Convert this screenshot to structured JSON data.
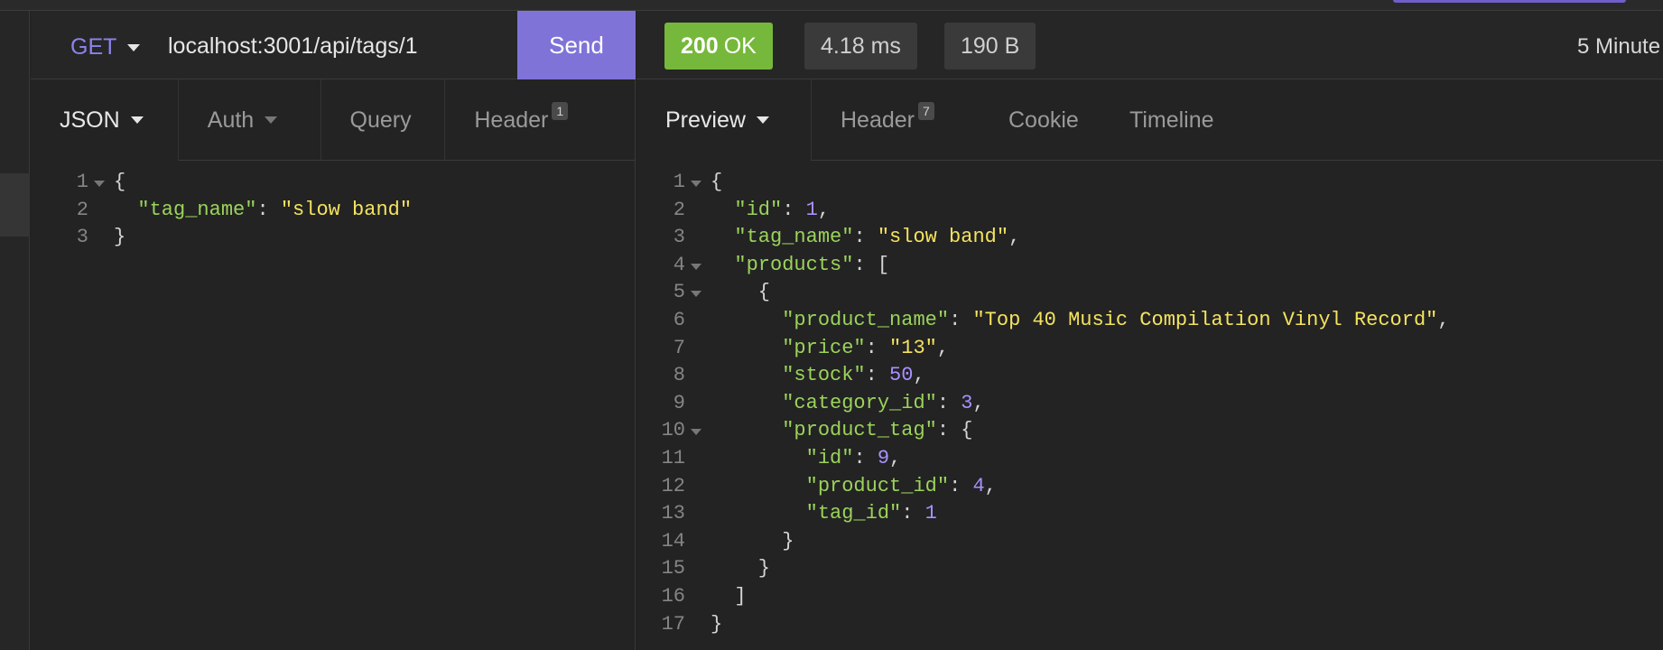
{
  "request": {
    "method": "GET",
    "url": "localhost:3001/api/tags/1",
    "send_label": "Send",
    "tabs": [
      {
        "label": "JSON",
        "count": ""
      },
      {
        "label": "Auth",
        "count": ""
      },
      {
        "label": "Query",
        "count": ""
      },
      {
        "label": "Header",
        "count": "1"
      }
    ],
    "body_lines": [
      {
        "n": "1",
        "fold": true,
        "parts": [
          [
            "p",
            "{"
          ]
        ]
      },
      {
        "n": "2",
        "fold": false,
        "parts": [
          [
            "p",
            "  "
          ],
          [
            "k",
            "\"tag_name\""
          ],
          [
            "p",
            ": "
          ],
          [
            "s",
            "\"slow band\""
          ]
        ]
      },
      {
        "n": "3",
        "fold": false,
        "parts": [
          [
            "p",
            "}"
          ]
        ]
      }
    ]
  },
  "response": {
    "status_code": "200",
    "status_text": "OK",
    "time": "4.18 ms",
    "size": "190 B",
    "ago": "5 Minute",
    "tabs": [
      {
        "label": "Preview",
        "count": ""
      },
      {
        "label": "Header",
        "count": "7"
      },
      {
        "label": "Cookie",
        "count": ""
      },
      {
        "label": "Timeline",
        "count": ""
      }
    ],
    "body_lines": [
      {
        "n": "1",
        "fold": true,
        "parts": [
          [
            "p",
            "{"
          ]
        ]
      },
      {
        "n": "2",
        "fold": false,
        "parts": [
          [
            "p",
            "  "
          ],
          [
            "k",
            "\"id\""
          ],
          [
            "p",
            ": "
          ],
          [
            "n",
            "1"
          ],
          [
            "p",
            ","
          ]
        ]
      },
      {
        "n": "3",
        "fold": false,
        "parts": [
          [
            "p",
            "  "
          ],
          [
            "k",
            "\"tag_name\""
          ],
          [
            "p",
            ": "
          ],
          [
            "s",
            "\"slow band\""
          ],
          [
            "p",
            ","
          ]
        ]
      },
      {
        "n": "4",
        "fold": true,
        "parts": [
          [
            "p",
            "  "
          ],
          [
            "k",
            "\"products\""
          ],
          [
            "p",
            ": ["
          ]
        ]
      },
      {
        "n": "5",
        "fold": true,
        "parts": [
          [
            "p",
            "    {"
          ]
        ]
      },
      {
        "n": "6",
        "fold": false,
        "parts": [
          [
            "p",
            "      "
          ],
          [
            "k",
            "\"product_name\""
          ],
          [
            "p",
            ": "
          ],
          [
            "s",
            "\"Top 40 Music Compilation Vinyl Record\""
          ],
          [
            "p",
            ","
          ]
        ]
      },
      {
        "n": "7",
        "fold": false,
        "parts": [
          [
            "p",
            "      "
          ],
          [
            "k",
            "\"price\""
          ],
          [
            "p",
            ": "
          ],
          [
            "s",
            "\"13\""
          ],
          [
            "p",
            ","
          ]
        ]
      },
      {
        "n": "8",
        "fold": false,
        "parts": [
          [
            "p",
            "      "
          ],
          [
            "k",
            "\"stock\""
          ],
          [
            "p",
            ": "
          ],
          [
            "n",
            "50"
          ],
          [
            "p",
            ","
          ]
        ]
      },
      {
        "n": "9",
        "fold": false,
        "parts": [
          [
            "p",
            "      "
          ],
          [
            "k",
            "\"category_id\""
          ],
          [
            "p",
            ": "
          ],
          [
            "n",
            "3"
          ],
          [
            "p",
            ","
          ]
        ]
      },
      {
        "n": "10",
        "fold": true,
        "parts": [
          [
            "p",
            "      "
          ],
          [
            "k",
            "\"product_tag\""
          ],
          [
            "p",
            ": {"
          ]
        ]
      },
      {
        "n": "11",
        "fold": false,
        "parts": [
          [
            "p",
            "        "
          ],
          [
            "k",
            "\"id\""
          ],
          [
            "p",
            ": "
          ],
          [
            "n",
            "9"
          ],
          [
            "p",
            ","
          ]
        ]
      },
      {
        "n": "12",
        "fold": false,
        "parts": [
          [
            "p",
            "        "
          ],
          [
            "k",
            "\"product_id\""
          ],
          [
            "p",
            ": "
          ],
          [
            "n",
            "4"
          ],
          [
            "p",
            ","
          ]
        ]
      },
      {
        "n": "13",
        "fold": false,
        "parts": [
          [
            "p",
            "        "
          ],
          [
            "k",
            "\"tag_id\""
          ],
          [
            "p",
            ": "
          ],
          [
            "n",
            "1"
          ]
        ]
      },
      {
        "n": "14",
        "fold": false,
        "parts": [
          [
            "p",
            "      }"
          ]
        ]
      },
      {
        "n": "15",
        "fold": false,
        "parts": [
          [
            "p",
            "    }"
          ]
        ]
      },
      {
        "n": "16",
        "fold": false,
        "parts": [
          [
            "p",
            "  ]"
          ]
        ]
      },
      {
        "n": "17",
        "fold": false,
        "parts": [
          [
            "p",
            "}"
          ]
        ]
      }
    ]
  },
  "colors": {
    "accent": "#7f73d8",
    "method": "#8b83ee",
    "ok": "#76b83b",
    "key": "#9bd35b",
    "string": "#f5e35f",
    "number": "#a991ff"
  }
}
